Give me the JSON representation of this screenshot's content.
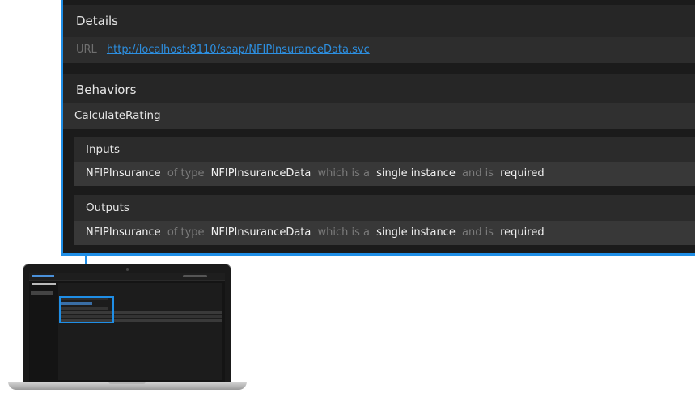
{
  "details": {
    "header": "Details",
    "url_label": "URL",
    "url_value": "http://localhost:8110/soap/NFIPInsuranceData.svc"
  },
  "behaviors": {
    "header": "Behaviors",
    "operation": "CalculateRating",
    "inputs": {
      "header": "Inputs",
      "param_name": "NFIPInsurance",
      "of_type_text": "of type",
      "type_name": "NFIPInsuranceData",
      "which_is_text": "which is a",
      "cardinality": "single instance",
      "and_is_text": "and is",
      "requirement": "required"
    },
    "outputs": {
      "header": "Outputs",
      "param_name": "NFIPInsurance",
      "of_type_text": "of type",
      "type_name": "NFIPInsuranceData",
      "which_is_text": "which is a",
      "cardinality": "single instance",
      "and_is_text": "and is",
      "requirement": "required"
    }
  },
  "colors": {
    "accent": "#1f8ee6",
    "link": "#2d8fe0",
    "background": "#1b1b1b"
  }
}
